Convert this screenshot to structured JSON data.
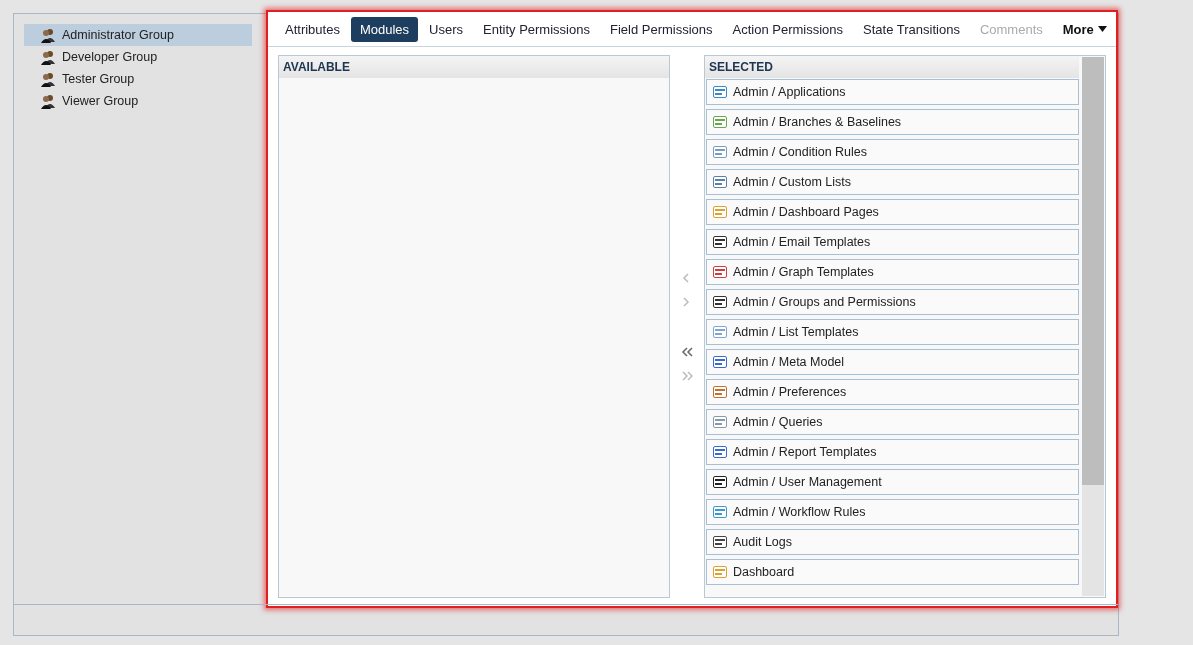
{
  "groups": [
    {
      "label": "Administrator Group",
      "selected": true
    },
    {
      "label": "Developer Group",
      "selected": false
    },
    {
      "label": "Tester Group",
      "selected": false
    },
    {
      "label": "Viewer Group",
      "selected": false
    }
  ],
  "tabs": [
    {
      "label": "Attributes",
      "selected": false,
      "disabled": false
    },
    {
      "label": "Modules",
      "selected": true,
      "disabled": false
    },
    {
      "label": "Users",
      "selected": false,
      "disabled": false
    },
    {
      "label": "Entity Permissions",
      "selected": false,
      "disabled": false
    },
    {
      "label": "Field Permissions",
      "selected": false,
      "disabled": false
    },
    {
      "label": "Action Permissions",
      "selected": false,
      "disabled": false
    },
    {
      "label": "State Transitions",
      "selected": false,
      "disabled": false
    },
    {
      "label": "Comments",
      "selected": false,
      "disabled": true
    }
  ],
  "more_menu": {
    "label": "More"
  },
  "available": {
    "title": "AVAILABLE"
  },
  "transfer_buttons": [
    {
      "kind": "left",
      "disabled": true
    },
    {
      "kind": "right",
      "disabled": true
    },
    {
      "kind": "all-left",
      "disabled": false
    },
    {
      "kind": "all-right",
      "disabled": true
    }
  ],
  "selected": {
    "title": "SELECTED",
    "items": [
      {
        "label": "Admin / Applications"
      },
      {
        "label": "Admin / Branches & Baselines"
      },
      {
        "label": "Admin / Condition Rules"
      },
      {
        "label": "Admin / Custom Lists"
      },
      {
        "label": "Admin / Dashboard Pages"
      },
      {
        "label": "Admin / Email Templates"
      },
      {
        "label": "Admin / Graph Templates"
      },
      {
        "label": "Admin / Groups and Permissions"
      },
      {
        "label": "Admin / List Templates"
      },
      {
        "label": "Admin / Meta Model"
      },
      {
        "label": "Admin / Preferences"
      },
      {
        "label": "Admin / Queries"
      },
      {
        "label": "Admin / Report Templates"
      },
      {
        "label": "Admin / User Management"
      },
      {
        "label": "Admin / Workflow Rules"
      },
      {
        "label": "Audit Logs"
      },
      {
        "label": "Dashboard"
      }
    ]
  }
}
